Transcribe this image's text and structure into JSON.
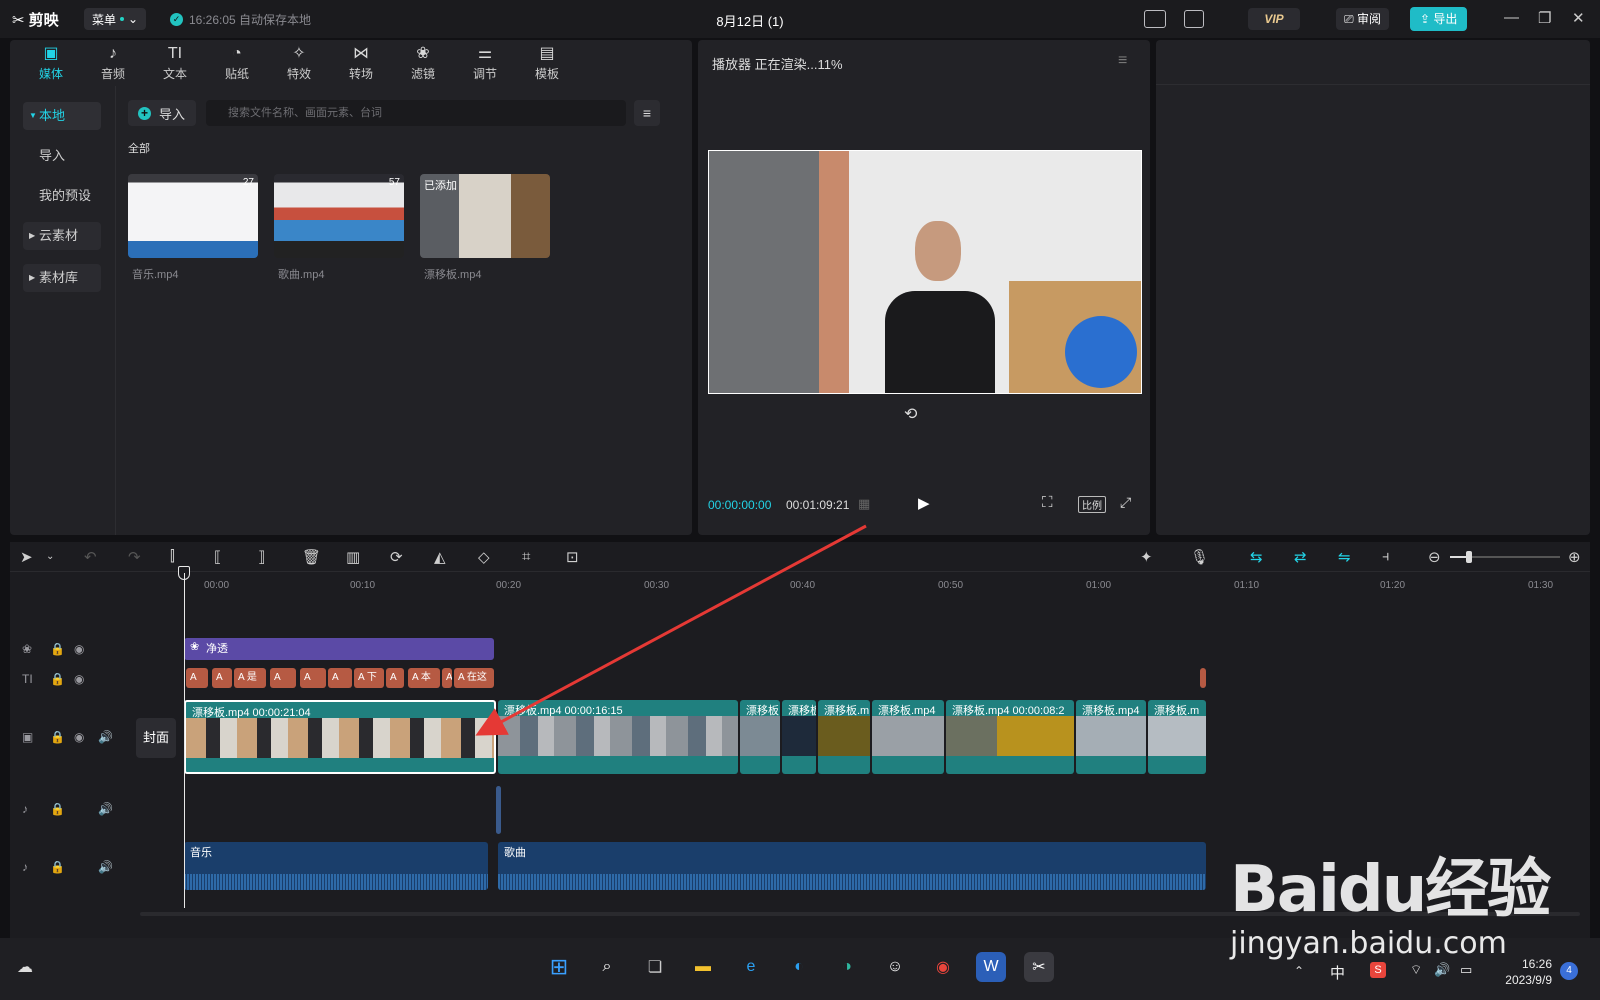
{
  "titlebar": {
    "logo": "剪映",
    "menu_label": "菜单",
    "save_status": "16:26:05 自动保存本地",
    "project_title": "8月12日 (1)",
    "vip_label": "VIP",
    "review_label": "审阅",
    "export_label": "导出"
  },
  "media_tabs": [
    {
      "label": "媒体",
      "icon": "▣"
    },
    {
      "label": "音频",
      "icon": "♪"
    },
    {
      "label": "文本",
      "icon": "TI"
    },
    {
      "label": "贴纸",
      "icon": "◔"
    },
    {
      "label": "特效",
      "icon": "✧"
    },
    {
      "label": "转场",
      "icon": "⋈"
    },
    {
      "label": "滤镜",
      "icon": "❀"
    },
    {
      "label": "调节",
      "icon": "⚌"
    },
    {
      "label": "模板",
      "icon": "▤"
    }
  ],
  "sidebar": {
    "local": "本地",
    "import": "导入",
    "presets": "我的预设",
    "cloud": "云素材",
    "library": "素材库"
  },
  "media": {
    "import_label": "导入",
    "search_placeholder": "搜索文件名称、画面元素、台词",
    "all_label": "全部",
    "items": [
      {
        "name": "音乐.mp4",
        "duration": "27",
        "badge": ""
      },
      {
        "name": "歌曲.mp4",
        "duration": "57",
        "badge": ""
      },
      {
        "name": "漂移板.mp4",
        "duration": "",
        "badge": "已添加"
      }
    ]
  },
  "player": {
    "title": "播放器 正在渲染...11%",
    "current_time": "00:00:00:00",
    "total_time": "00:01:09:21",
    "ratio_label": "比例"
  },
  "ruler": [
    "00:00",
    "00:10",
    "00:20",
    "00:30",
    "00:40",
    "00:50",
    "01:00",
    "01:10",
    "01:20",
    "01:30"
  ],
  "tracks": {
    "filter_label": "净透",
    "text_chips": [
      "A",
      "A",
      "A 是",
      "A",
      "A",
      "A",
      "A 下",
      "A",
      "A 本",
      "A",
      "A 在这"
    ],
    "cover_label": "封面",
    "video_clips": [
      {
        "label": "漂移板.mp4   00:00:21:04"
      },
      {
        "label": "漂移板.mp4   00:00:16:15"
      },
      {
        "label": "漂移板."
      },
      {
        "label": "漂移板"
      },
      {
        "label": "漂移板.m"
      },
      {
        "label": "漂移板.mp4"
      },
      {
        "label": "漂移板.mp4   00:00:08:2"
      },
      {
        "label": "漂移板.mp4"
      },
      {
        "label": "漂移板.m"
      }
    ],
    "audio_clips": [
      {
        "label": "音乐"
      },
      {
        "label": "歌曲"
      }
    ]
  },
  "taskbar": {
    "ime": "中",
    "time": "16:26",
    "date": "2023/9/9",
    "notifications": "4"
  },
  "watermark": {
    "brand": "Baidu经验",
    "url": "jingyan.baidu.com"
  },
  "colors": {
    "accent": "#22d3e6",
    "export": "#1fbcc7",
    "filter_clip": "#5b4aa6",
    "text_clip": "#b65a43",
    "video_clip": "#20807f",
    "audio_clip": "#1a3e6b",
    "annotation_arrow": "#e53935"
  }
}
